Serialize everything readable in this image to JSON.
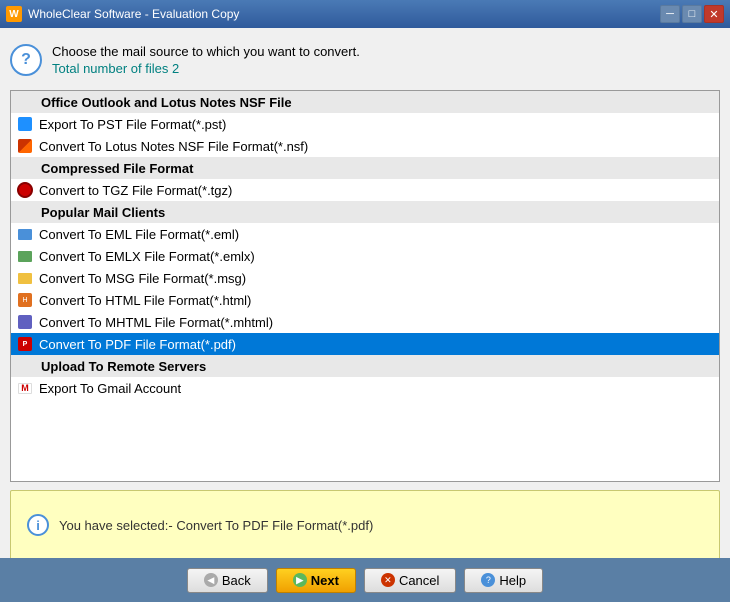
{
  "window": {
    "title": "WholeClear Software - Evaluation Copy",
    "icon": "W"
  },
  "header": {
    "main_text": "Choose the mail source to which you want to convert.",
    "sub_text": "Total number of files 2"
  },
  "list": {
    "items": [
      {
        "id": "cat-office",
        "type": "category",
        "label": "Office Outlook and Lotus Notes NSF File",
        "icon": "none"
      },
      {
        "id": "pst",
        "type": "item",
        "label": "Export To PST File Format(*.pst)",
        "icon": "pst"
      },
      {
        "id": "nsf",
        "type": "item",
        "label": "Convert To Lotus Notes NSF File Format(*.nsf)",
        "icon": "nsf"
      },
      {
        "id": "cat-compressed",
        "type": "category",
        "label": "Compressed File Format",
        "icon": "none"
      },
      {
        "id": "tgz",
        "type": "item",
        "label": "Convert to TGZ File Format(*.tgz)",
        "icon": "tgz"
      },
      {
        "id": "cat-popular",
        "type": "category",
        "label": "Popular Mail Clients",
        "icon": "none"
      },
      {
        "id": "eml",
        "type": "item",
        "label": "Convert To EML File Format(*.eml)",
        "icon": "eml"
      },
      {
        "id": "emlx",
        "type": "item",
        "label": "Convert To EMLX File Format(*.emlx)",
        "icon": "emlx"
      },
      {
        "id": "msg",
        "type": "item",
        "label": "Convert To MSG File Format(*.msg)",
        "icon": "msg"
      },
      {
        "id": "html",
        "type": "item",
        "label": "Convert To HTML File Format(*.html)",
        "icon": "html"
      },
      {
        "id": "mhtml",
        "type": "item",
        "label": "Convert To MHTML File Format(*.mhtml)",
        "icon": "mhtml"
      },
      {
        "id": "pdf",
        "type": "item",
        "label": "Convert To PDF File Format(*.pdf)",
        "icon": "pdf",
        "selected": true
      },
      {
        "id": "cat-remote",
        "type": "category",
        "label": "Upload To Remote Servers",
        "icon": "none"
      },
      {
        "id": "gmail",
        "type": "item",
        "label": "Export To Gmail Account",
        "icon": "gmail"
      }
    ]
  },
  "selection_box": {
    "text": "You have selected:- Convert To PDF File Format(*.pdf)"
  },
  "buttons": {
    "back": "Back",
    "next": "Next",
    "cancel": "Cancel",
    "help": "Help"
  }
}
